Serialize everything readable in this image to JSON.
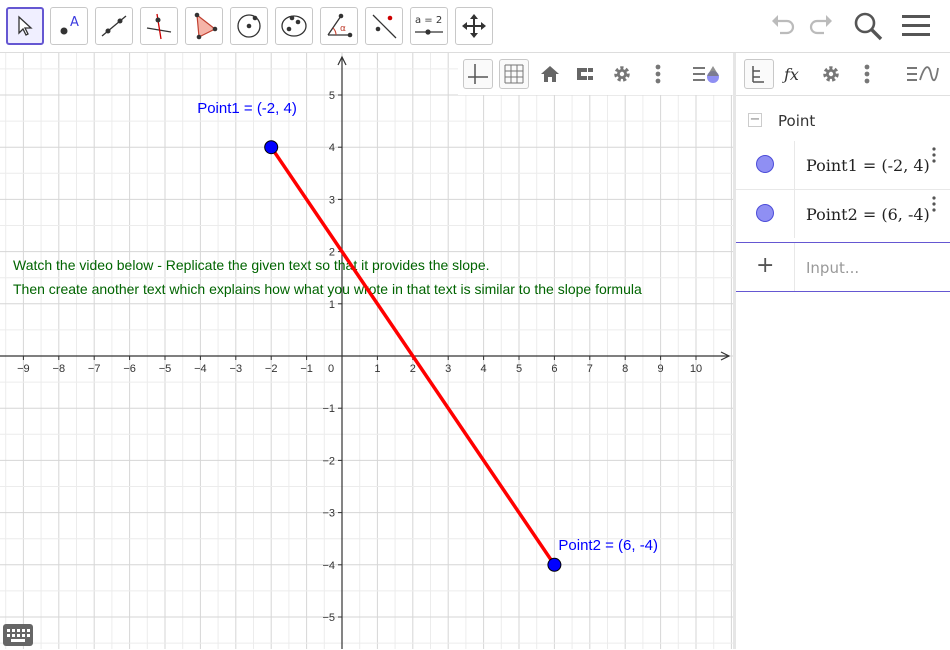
{
  "toolbar": {
    "tools": [
      {
        "name": "move-tool"
      },
      {
        "name": "point-tool",
        "glyph": "A"
      },
      {
        "name": "line-tool"
      },
      {
        "name": "perpendicular-tool"
      },
      {
        "name": "polygon-tool"
      },
      {
        "name": "circle-tool"
      },
      {
        "name": "conic-tool"
      },
      {
        "name": "angle-tool",
        "glyph": "α"
      },
      {
        "name": "reflect-tool"
      },
      {
        "name": "slider-tool",
        "glyph": "a = 2"
      },
      {
        "name": "move-view-tool"
      }
    ]
  },
  "graphics": {
    "x_ticks": [
      "−9",
      "−8",
      "−7",
      "−6",
      "−5",
      "−4",
      "−3",
      "−2",
      "−1",
      "0",
      "1",
      "2",
      "3",
      "4",
      "5",
      "6",
      "7",
      "8",
      "9",
      "10"
    ],
    "y_ticks_pos": [
      "1",
      "2",
      "3",
      "4",
      "5"
    ],
    "y_ticks_neg": [
      "−1",
      "−2",
      "−3",
      "−4",
      "−5"
    ],
    "points": [
      {
        "name": "Point1",
        "x": -2,
        "y": 4,
        "label": "Point1 = (-2, 4)"
      },
      {
        "name": "Point2",
        "x": 6,
        "y": -4,
        "label": "Point2 = (6, -4)"
      }
    ],
    "segment_color": "#ff0000",
    "point_color": "#0000ff",
    "text_line1": "Watch the video below - Replicate the given text so that it provides the slope.",
    "text_line2": "Then create another text which explains how what you wrote in that text is similar to the slope formula",
    "text_color": "#006400"
  },
  "algebra": {
    "group_label": "Point",
    "group_toggle": "−",
    "items": [
      {
        "text": "Point1 = (-2, 4)"
      },
      {
        "text": "Point2 = (6, -4)"
      }
    ],
    "input_placeholder": "Input...",
    "input_plus": "+"
  },
  "colors": {
    "accent": "#6557d2",
    "point_fill": "#8f8ff3"
  }
}
